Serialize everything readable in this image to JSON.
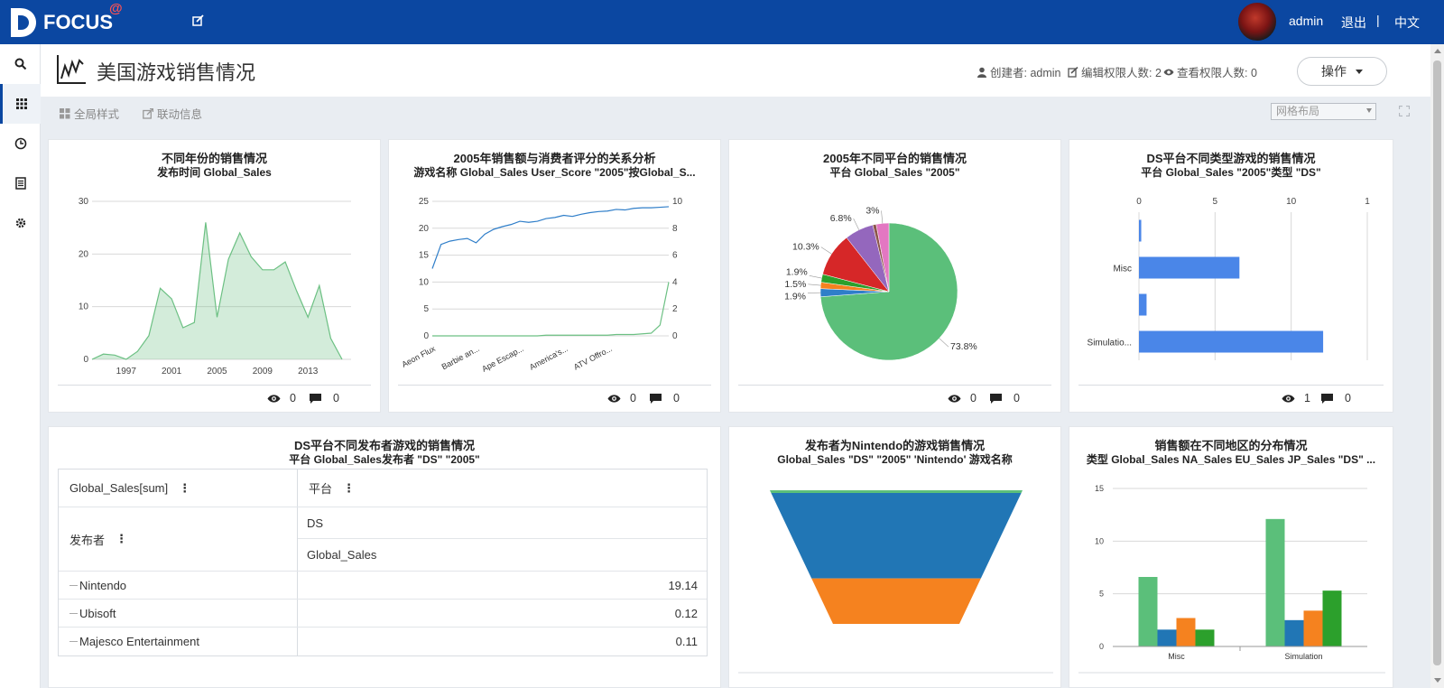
{
  "topbar": {
    "logo_text": "FOCUS",
    "logo_at": "@",
    "user": "admin",
    "logout": "退出",
    "separator": "|",
    "language": "中文",
    "brand_color": "#0b47a1"
  },
  "sidebar": {
    "items": [
      {
        "icon": "search-icon"
      },
      {
        "icon": "grid-icon",
        "active": true
      },
      {
        "icon": "clock-icon"
      },
      {
        "icon": "list-icon"
      },
      {
        "icon": "gear-icon"
      }
    ]
  },
  "header": {
    "title": "美国游戏销售情况",
    "creator": "创建者: admin",
    "edit_count": "编辑权限人数: 2",
    "view_count": "查看权限人数: 0",
    "operation": "操作"
  },
  "toolbar": {
    "global_style": "全局样式",
    "link_info": "联动信息",
    "layout": "网格布局"
  },
  "cards": [
    {
      "title": "不同年份的销售情况",
      "subtitle": "发布时间 Global_Sales",
      "views": "0",
      "comments": "0",
      "chart_data": {
        "type": "area",
        "x": [
          1994,
          1995,
          1996,
          1997,
          1998,
          1999,
          2000,
          2001,
          2002,
          2003,
          2004,
          2005,
          2006,
          2007,
          2008,
          2009,
          2010,
          2011,
          2012,
          2013,
          2014,
          2015,
          2016
        ],
        "values": [
          0,
          1,
          0.8,
          0,
          1.5,
          4.5,
          13.5,
          11.5,
          6,
          7,
          26,
          8,
          19,
          24,
          19.5,
          17,
          17,
          18.5,
          13,
          8,
          14,
          4,
          0
        ],
        "x_ticks": [
          "1997",
          "2001",
          "2005",
          "2009",
          "2013"
        ],
        "y_ticks": [
          "0",
          "10",
          "20",
          "30"
        ],
        "ylim": [
          0,
          30
        ],
        "color": "#6cc083"
      }
    },
    {
      "title": "2005年销售额与消费者评分的关系分析",
      "subtitle": "游戏名称 Global_Sales User_Score \"2005\"按Global_S...",
      "views": "0",
      "comments": "0",
      "chart_data": {
        "type": "line",
        "categories": [
          "Aeon Flux",
          "Barbie an...",
          "Ape Escap...",
          "America's...",
          "ATV Offro..."
        ],
        "y_ticks_left": [
          "0",
          "5",
          "10",
          "15",
          "20",
          "25"
        ],
        "y_ticks_right": [
          "0",
          "2",
          "4",
          "6",
          "8",
          "10"
        ],
        "series": [
          {
            "color": "#2f7ec9",
            "values": [
              12.5,
              17,
              17.6,
              17.9,
              18.1,
              17.3,
              18.9,
              19.8,
              20.3,
              20.7,
              21.3,
              21.1,
              21.3,
              21.8,
              22.0,
              22.4,
              22.2,
              22.6,
              22.9,
              23.1,
              23.2,
              23.5,
              23.4,
              23.7,
              23.8,
              23.8,
              23.9,
              24.0
            ]
          },
          {
            "color": "#6cc083",
            "values_right": [
              0,
              0,
              0,
              0,
              0,
              0,
              0,
              0,
              0,
              0,
              0,
              0,
              0,
              0.05,
              0.05,
              0.05,
              0.05,
              0.05,
              0.05,
              0.05,
              0.05,
              0.1,
              0.1,
              0.1,
              0.15,
              0.2,
              0.8,
              4.0
            ]
          }
        ]
      }
    },
    {
      "title": "2005年不同平台的销售情况",
      "subtitle": "平台 Global_Sales \"2005\"",
      "views": "0",
      "comments": "0",
      "chart_data": {
        "type": "pie",
        "slices": [
          {
            "label": "73.8%",
            "value": 73.8,
            "color": "#5bbf7a"
          },
          {
            "label": "1.9%",
            "value": 1.9,
            "color": "#2f7ec9"
          },
          {
            "label": "1.5%",
            "value": 1.5,
            "color": "#f5821f"
          },
          {
            "label": "1.9%",
            "value": 1.9,
            "color": "#2ca02c"
          },
          {
            "label": "10.3%",
            "value": 10.3,
            "color": "#d62728"
          },
          {
            "label": "6.8%",
            "value": 6.8,
            "color": "#9467bd"
          },
          {
            "label": "",
            "value": 0.8,
            "color": "#8c564b"
          },
          {
            "label": "3%",
            "value": 3.0,
            "color": "#e377c2"
          }
        ]
      }
    },
    {
      "title": "DS平台不同类型游戏的销售情况",
      "subtitle": "平台 Global_Sales \"2005\"类型 \"DS\"",
      "views": "1",
      "comments": "0",
      "chart_data": {
        "type": "bar",
        "orientation": "horizontal",
        "categories": [
          "",
          "Misc",
          "",
          "Simulatio..."
        ],
        "values": [
          0.15,
          6.6,
          0.5,
          12.1
        ],
        "x_ticks": [
          "0",
          "5",
          "10",
          "1"
        ],
        "xlim": [
          0,
          15
        ],
        "color": "#4a86e8"
      }
    },
    {
      "title": "DS平台不同发布者游戏的销售情况",
      "subtitle": "平台 Global_Sales发布者 \"DS\" \"2005\"",
      "table": {
        "header_left": "Global_Sales[sum]",
        "header_right": "平台",
        "row_label": "发布者",
        "sub_header_1": "DS",
        "sub_header_2": "Global_Sales",
        "rows": [
          {
            "name": "Nintendo",
            "value": "19.14"
          },
          {
            "name": "Ubisoft",
            "value": "0.12"
          },
          {
            "name": "Majesco Entertainment",
            "value": "0.11"
          }
        ]
      }
    },
    {
      "title": "发布者为Nintendo的游戏销售情况",
      "subtitle": "Global_Sales \"DS\" \"2005\" 'Nintendo' 游戏名称",
      "chart_data": {
        "type": "funnel",
        "segments": [
          {
            "value": 0.2,
            "color": "#5bbf7a"
          },
          {
            "value": 6.4,
            "color": "#2176b5"
          },
          {
            "value": 3.4,
            "color": "#f5821f"
          }
        ]
      }
    },
    {
      "title": "销售额在不同地区的分布情况",
      "subtitle": "类型 Global_Sales NA_Sales EU_Sales JP_Sales \"DS\" ...",
      "chart_data": {
        "type": "bar",
        "categories": [
          "Misc",
          "Simulation"
        ],
        "y_ticks": [
          "0",
          "5",
          "10",
          "15"
        ],
        "ylim": [
          0,
          15
        ],
        "series": [
          {
            "color": "#5bbf7a",
            "values": [
              6.6,
              12.1
            ]
          },
          {
            "color": "#2176b5",
            "values": [
              1.6,
              2.5
            ]
          },
          {
            "color": "#f5821f",
            "values": [
              2.7,
              3.4
            ]
          },
          {
            "color": "#2ca02c",
            "values": [
              1.6,
              5.3
            ]
          }
        ]
      }
    }
  ]
}
